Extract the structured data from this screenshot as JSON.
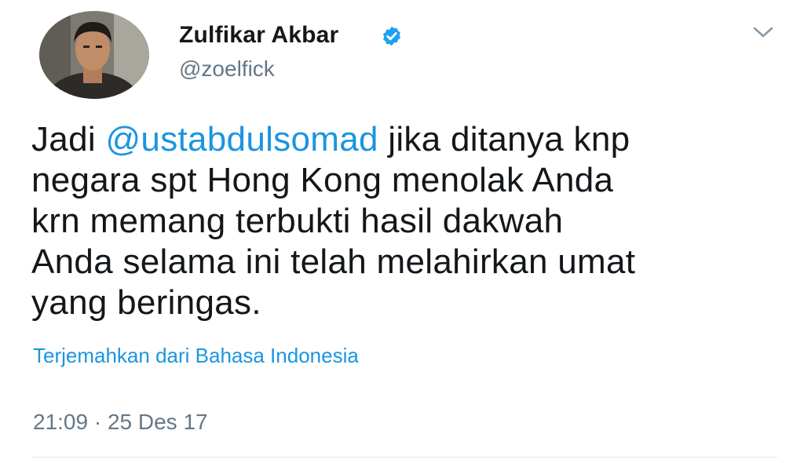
{
  "tweet": {
    "author": {
      "display_name": "Zulfikar Akbar",
      "handle": "@zoelfick",
      "verified": true,
      "avatar_icon": "profile-photo"
    },
    "menu_icon": "chevron-down-icon",
    "text_lines": [
      {
        "prefix": "Jadi ",
        "mention": "@ustabdulsomad",
        "suffix": " jika ditanya knp"
      },
      {
        "text": "negara spt Hong Kong menolak Anda"
      },
      {
        "text": "krn memang terbukti hasil dakwah"
      },
      {
        "text": "Anda selama ini telah melahirkan umat"
      },
      {
        "text": "yang beringas."
      }
    ],
    "translate_link": "Terjemahkan dari Bahasa Indonesia",
    "timestamp": "21:09 · 25 Des 17"
  },
  "colors": {
    "accent": "#1b95e0",
    "text": "#14171a",
    "muted": "#657786",
    "verified_badge": "#1da1f2"
  }
}
